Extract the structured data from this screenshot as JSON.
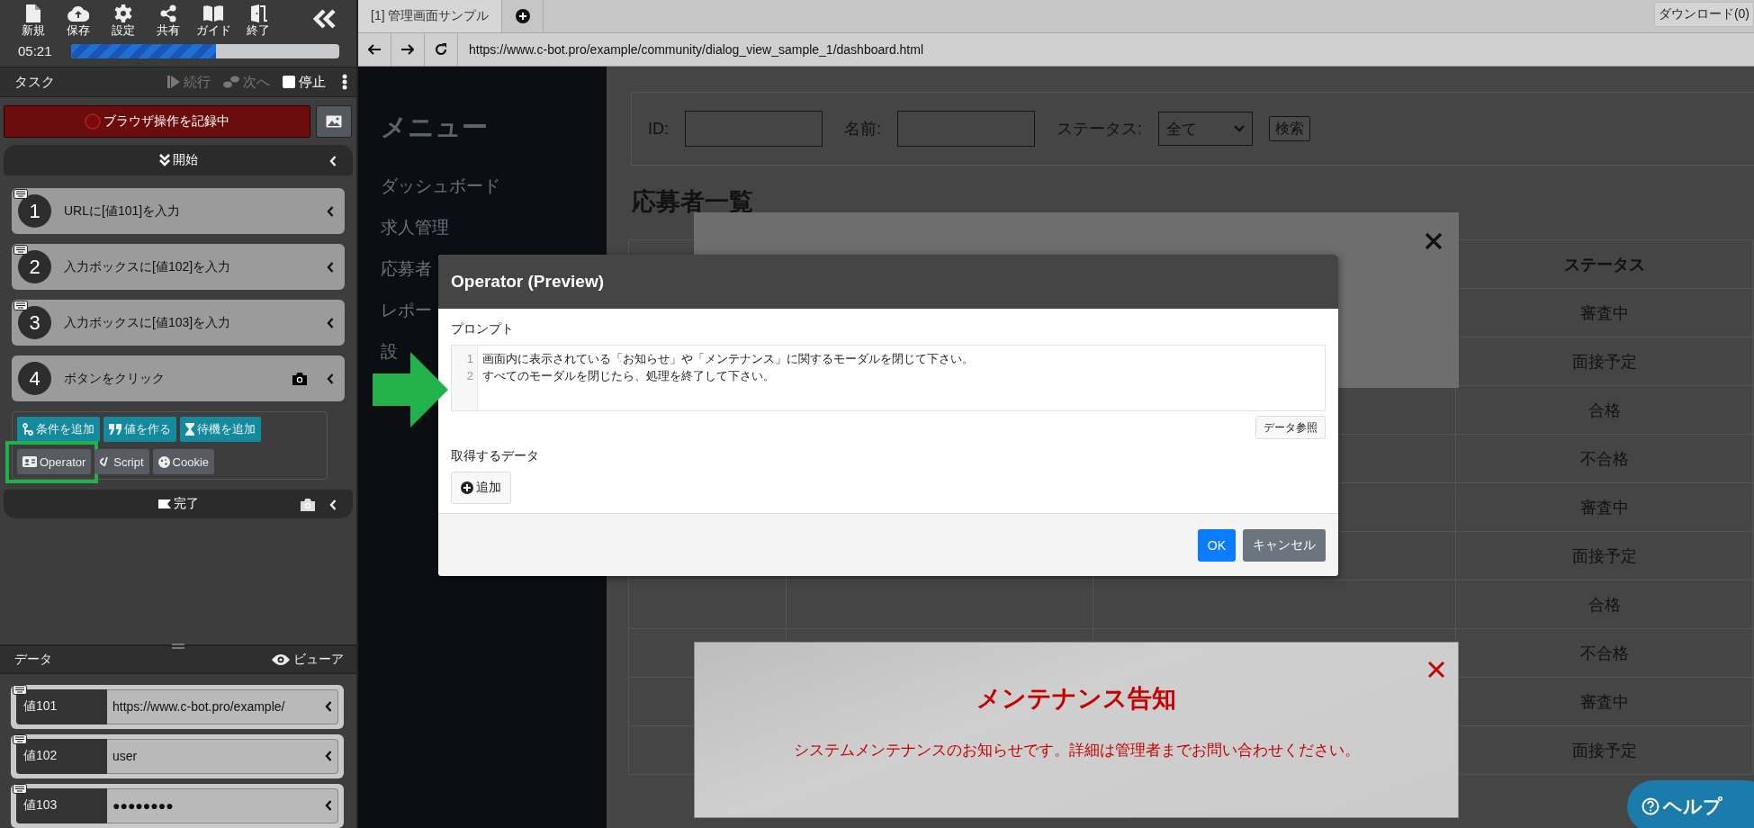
{
  "tool_panel": {
    "toolbar": [
      {
        "label": "新規"
      },
      {
        "label": "保存"
      },
      {
        "label": "設定"
      },
      {
        "label": "共有"
      },
      {
        "label": "ガイド"
      },
      {
        "label": "終了"
      }
    ],
    "timer": "05:21",
    "progress": {
      "level": 0.54
    },
    "task_header": {
      "title": "タスク",
      "actions": [
        {
          "label": "続行",
          "disabled": true
        },
        {
          "label": "次へ",
          "disabled": true
        },
        {
          "label": "停止",
          "disabled": false
        }
      ]
    },
    "record_button": {
      "label": "ブラウザ操作を記録中"
    },
    "start": {
      "label": "開始"
    },
    "steps": [
      {
        "number": "1",
        "label": "URLに[値101]を入力",
        "kind": "input",
        "camera": false
      },
      {
        "number": "2",
        "label": "入力ボックスに[値102]を入力",
        "kind": "input",
        "camera": false
      },
      {
        "number": "3",
        "label": "入力ボックスに[値103]を入力",
        "kind": "input",
        "camera": false
      },
      {
        "number": "4",
        "label": "ボタンをクリック",
        "kind": "click",
        "camera": true
      }
    ],
    "add_actions": [
      {
        "label": "条件を追加",
        "kind": "accent",
        "highlighted": false
      },
      {
        "label": "値を作る",
        "kind": "accent",
        "highlighted": false
      },
      {
        "label": "待機を追加",
        "kind": "accent",
        "highlighted": false
      },
      {
        "label": "Operator",
        "kind": "plain",
        "highlighted": true
      },
      {
        "label": "Script",
        "kind": "plain",
        "highlighted": false
      },
      {
        "label": "Cookie",
        "kind": "plain",
        "highlighted": false
      }
    ],
    "finish": {
      "label": "完了",
      "camera": true
    },
    "data": {
      "title": "データ",
      "viewer": "ビューア",
      "rows": [
        {
          "name": "値101",
          "value": "https://www.c-bot.pro/example/"
        },
        {
          "name": "値102",
          "value": "user"
        },
        {
          "name": "値103",
          "value": "●●●●●●●●"
        }
      ]
    }
  },
  "browser": {
    "tabs": [
      {
        "label": "[1] 管理画面サンプル",
        "selected": true
      }
    ],
    "download": "ダウンロード(0)",
    "url": "https://www.c-bot.pro/example/community/dialog_view_sample_1/dashboard.html",
    "page": {
      "menu_title": "メニュー",
      "menu_items": [
        "ダッシュボード",
        "求人管理",
        "応募者",
        "レポー",
        "設"
      ],
      "search": {
        "fields": [
          {
            "label": "ID:"
          },
          {
            "label": "名前:"
          }
        ],
        "status_label": "ステータス:",
        "status_value": "全て",
        "button": "検索"
      },
      "heading": "応募者一覧",
      "table": {
        "status_header": "ステータス",
        "statuses": [
          "審査中",
          "面接予定",
          "合格",
          "不合格",
          "審査中",
          "面接予定",
          "合格",
          "不合格",
          "審査中",
          "面接予定"
        ]
      }
    },
    "dialog": {
      "title": "Operator (Preview)",
      "prompt_label": "プロンプト",
      "prompt_lines": [
        {
          "number": "1",
          "text": "画面内に表示されている「お知らせ」や「メンテナンス」に関するモーダルを閉じて下さい。"
        },
        {
          "number": "2",
          "text": "すべてのモーダルを閉じたら、処理を終了して下さい。"
        }
      ],
      "data_ref_button": "データ参照",
      "get_data_label": "取得するデータ",
      "add_button": "追加",
      "ok_button": "OK",
      "cancel_button": "キャンセル"
    },
    "maintenance": {
      "title": "メンテナンス告知",
      "message": "システムメンテナンスのお知らせです。詳細は管理者までお問い合わせください。"
    },
    "help_button": "ヘルプ"
  }
}
